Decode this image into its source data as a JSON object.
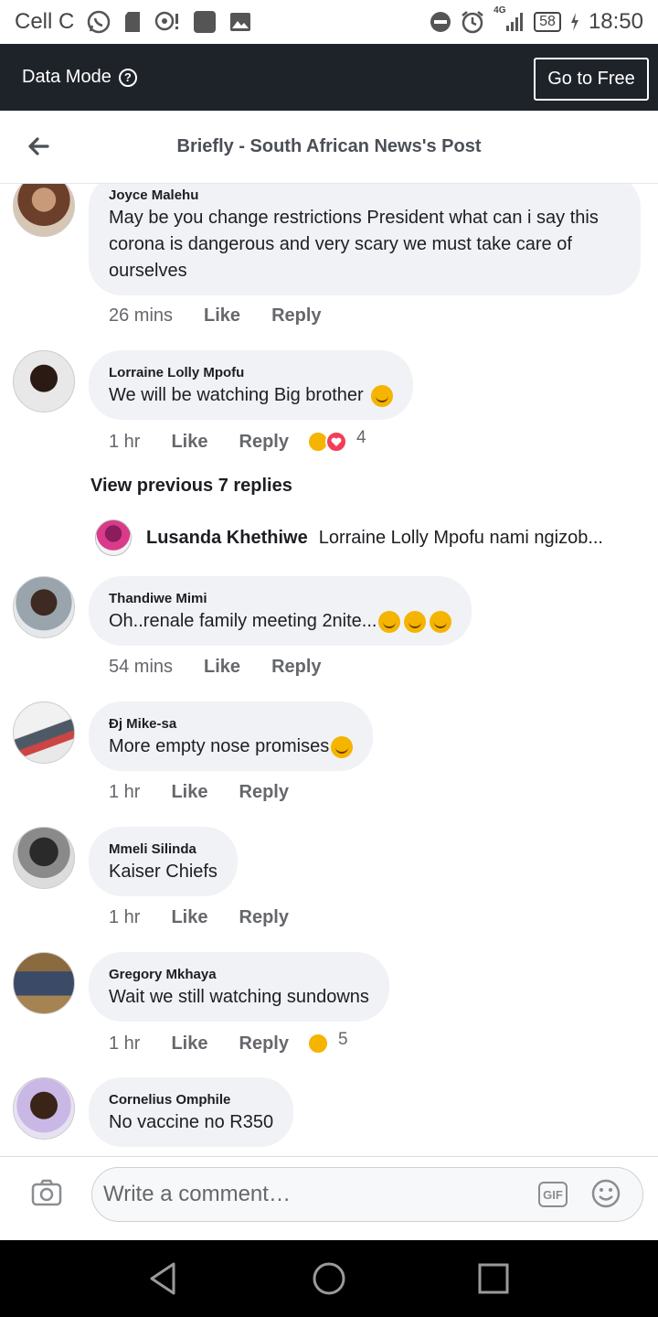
{
  "status_bar": {
    "carrier": "Cell C",
    "network": "4G",
    "battery": "58",
    "time": "18:50"
  },
  "data_bar": {
    "label": "Data Mode",
    "go_free": "Go to Free"
  },
  "header": {
    "title": "Briefly - South African News's Post"
  },
  "comments": [
    {
      "author": "Joyce Malehu",
      "text": "May  be you   change  restrictions   President what  can i say this corona  is dangerous  and very scary we must take care of ourselves",
      "time": "26 mins",
      "like": "Like",
      "reply": "Reply",
      "reaction_count": ""
    },
    {
      "author": "Lorraine Lolly Mpofu",
      "text": "We will be watching Big brother",
      "time": "1 hr",
      "like": "Like",
      "reply": "Reply",
      "reaction_count": "4"
    },
    {
      "author": "Thandiwe Mimi",
      "text": "Oh..renale family meeting 2nite...",
      "time": "54 mins",
      "like": "Like",
      "reply": "Reply",
      "reaction_count": ""
    },
    {
      "author": "Đj Mike-sa",
      "text": "More empty nose promises",
      "time": "1 hr",
      "like": "Like",
      "reply": "Reply",
      "reaction_count": ""
    },
    {
      "author": "Mmeli Silinda",
      "text": "Kaiser Chiefs",
      "time": "1 hr",
      "like": "Like",
      "reply": "Reply",
      "reaction_count": ""
    },
    {
      "author": "Gregory Mkhaya",
      "text": "Wait we still watching sundowns",
      "time": "1 hr",
      "like": "Like",
      "reply": "Reply",
      "reaction_count": "5"
    },
    {
      "author": "Cornelius Omphile",
      "text": "No vaccine no R350",
      "time": "",
      "like": "",
      "reply": "",
      "reaction_count": ""
    }
  ],
  "view_previous": "View previous 7 replies",
  "reply_preview": {
    "author": "Lusanda Khethiwe",
    "text": "Lorraine Lolly Mpofu nami ngizob..."
  },
  "composer": {
    "placeholder": "Write a comment…",
    "gif_label": "GIF"
  },
  "icons": {
    "reaction_haha_color": "#f5b400",
    "reaction_love_color": "#f33e58"
  }
}
